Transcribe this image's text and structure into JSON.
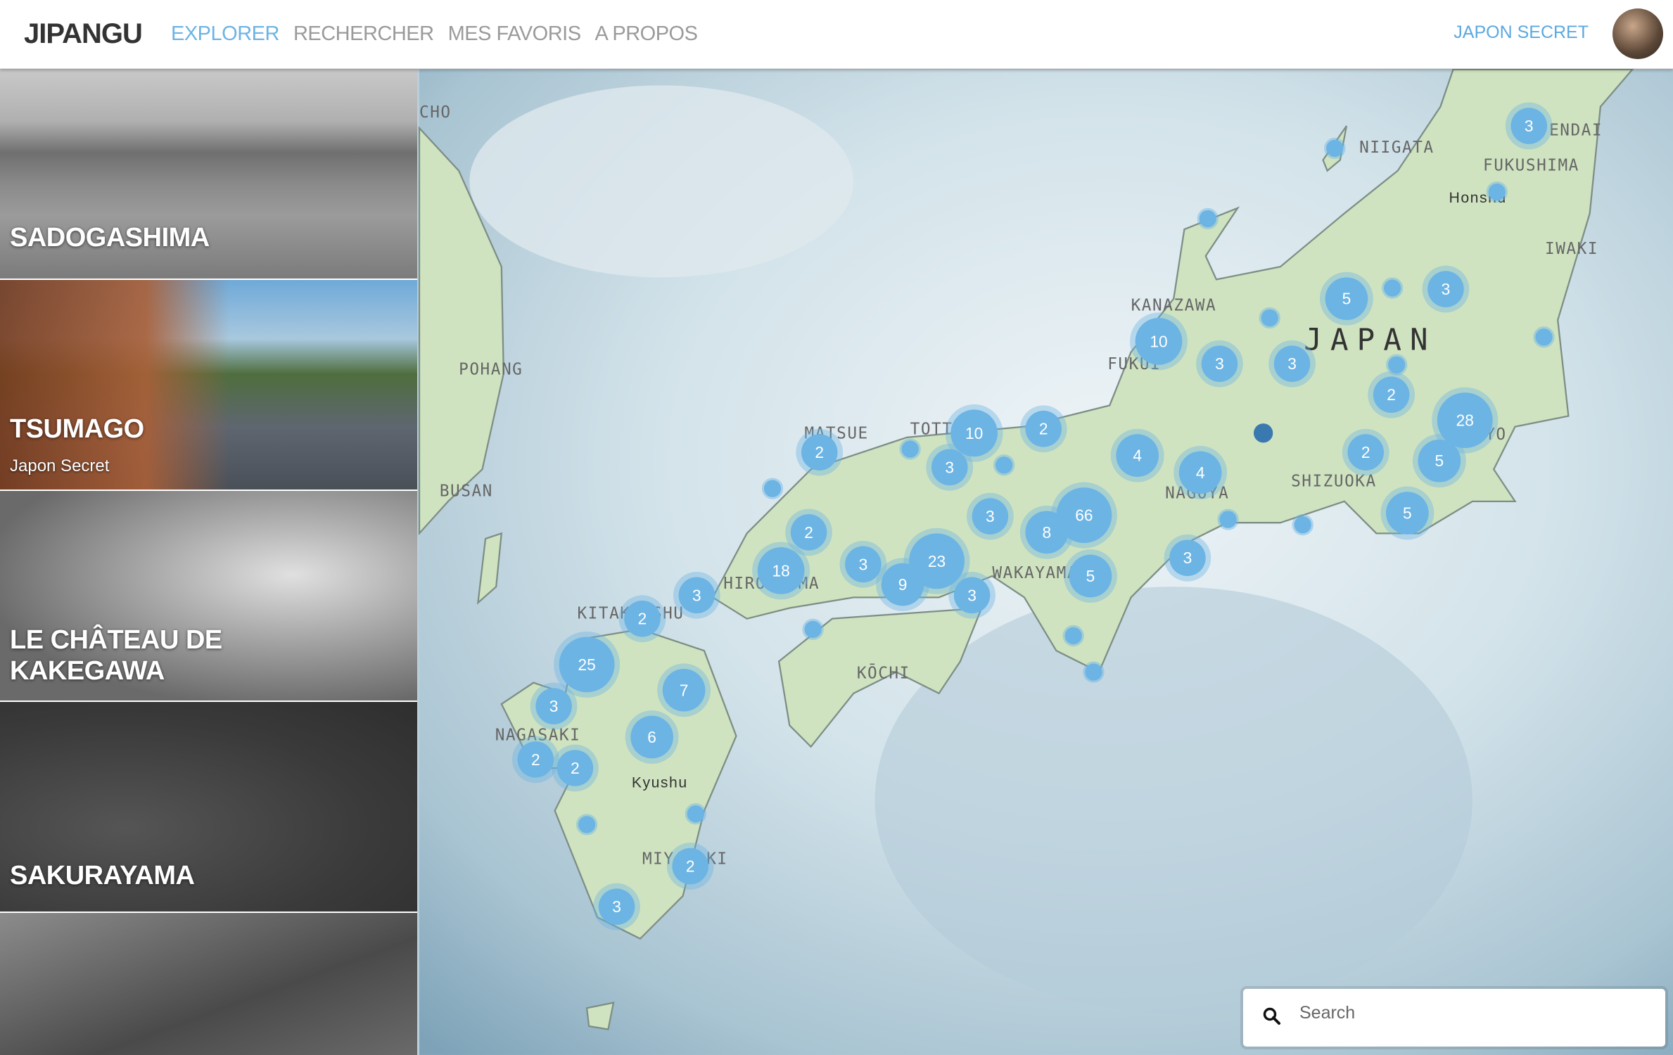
{
  "header": {
    "logo": "JIPANGU",
    "nav": [
      {
        "label": "EXPLORER",
        "active": true
      },
      {
        "label": "RECHERCHER"
      },
      {
        "label": "MES FAVORIS"
      },
      {
        "label": "A PROPOS"
      }
    ],
    "brand": "JAPON SECRET"
  },
  "sidebar": {
    "items": [
      {
        "title": "SADOGASHIMA"
      },
      {
        "title": "TSUMAGO",
        "subtitle": "Japon Secret"
      },
      {
        "title": "LE CHÂTEAU DE KAKEGAWA"
      },
      {
        "title": "SAKURAYAMA"
      },
      {
        "title": ""
      }
    ]
  },
  "map": {
    "labels": [
      "CHO",
      "NIIGATA",
      "ENDAI",
      "FUKUSHIMA",
      "Honshu",
      "IWAKI",
      "KANAZAWA",
      "JAPAN",
      "FUKUI",
      "POHANG",
      "MATSUE",
      "TOTT",
      "BUSAN",
      "NAGOYA",
      "SHIZUOKA",
      "TOKYO",
      "HIROSHIMA",
      "WAKAYAMA",
      "KITAKYUSHU",
      "KŌCHI",
      "NAGASAKI",
      "Kyushu",
      "MIYAZAKI"
    ],
    "clusters": [
      3,
      5,
      3,
      10,
      3,
      3,
      2,
      28,
      2,
      10,
      2,
      3,
      4,
      4,
      2,
      5,
      5,
      3,
      66,
      8,
      2,
      18,
      3,
      23,
      9,
      3,
      5,
      3,
      3,
      2,
      25,
      7,
      3,
      6,
      2,
      2,
      2,
      3
    ],
    "cluster_color": "#6cb4e4",
    "selected_marker_color": "#3a78b0"
  },
  "search": {
    "placeholder": "Search",
    "icon": "search-icon"
  }
}
